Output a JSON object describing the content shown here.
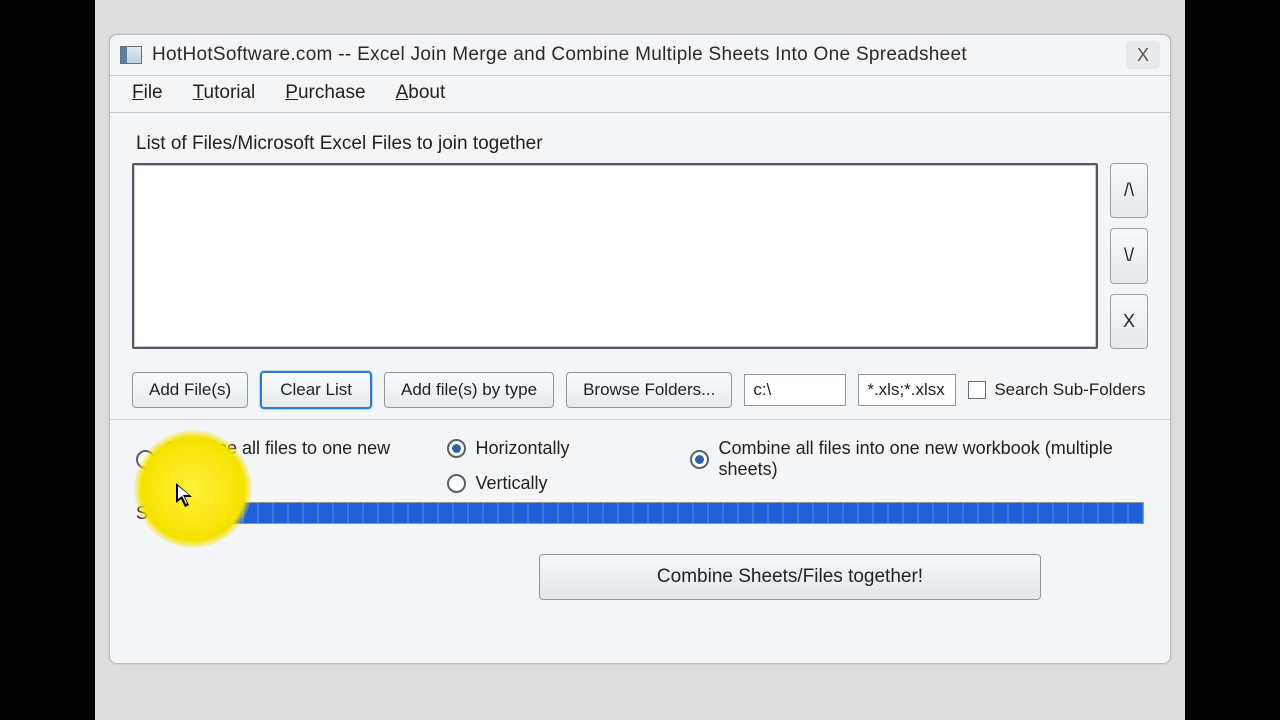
{
  "title": "HotHotSoftware.com -- Excel Join Merge and Combine Multiple Sheets Into One Spreadsheet",
  "menu": {
    "file": "File",
    "tutorial": "Tutorial",
    "purchase": "Purchase",
    "about": "About"
  },
  "section_label": "List of Files/Microsoft Excel Files to join together",
  "side": {
    "up": "/\\",
    "down": "\\/",
    "remove": "X"
  },
  "toolbar": {
    "add_files": "Add File(s)",
    "clear_list": "Clear List",
    "add_by_type": "Add file(s) by type",
    "browse": "Browse Folders...",
    "path_value": "c:\\",
    "ext_value": "*.xls;*.xlsx",
    "search_sub": "Search Sub-Folders"
  },
  "options": {
    "combine_one_sheet": "Combine all files to one new sheet",
    "horizontal": "Horizontally",
    "vertical": "Vertically",
    "combine_workbook": "Combine all files into one new workbook (multiple sheets)"
  },
  "status_label": "Status:",
  "action_button": "Combine Sheets/Files together!"
}
